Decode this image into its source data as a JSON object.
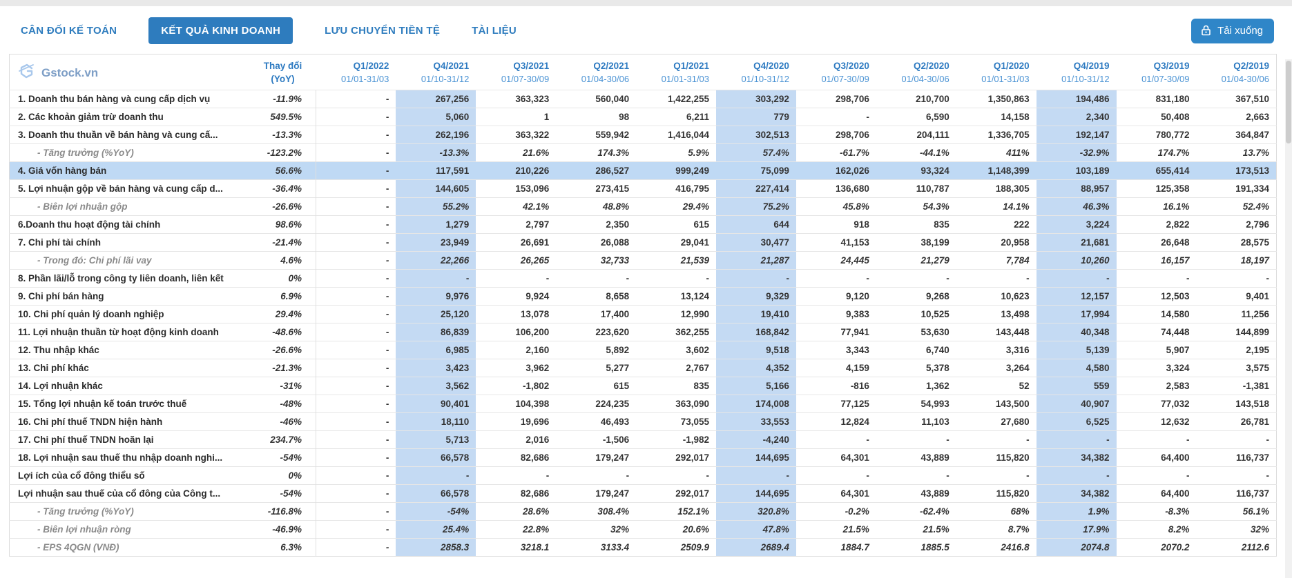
{
  "tabs": [
    {
      "label": "CÂN ĐỐI KẾ TOÁN",
      "active": false
    },
    {
      "label": "KẾT QUẢ KINH DOANH",
      "active": true
    },
    {
      "label": "LƯU CHUYỂN TIỀN TỆ",
      "active": false
    },
    {
      "label": "TÀI LIỆU",
      "active": false
    }
  ],
  "toolbar": {
    "download_label": "Tải xuống"
  },
  "brand": {
    "name": "Gstock.vn"
  },
  "colors": {
    "accent_blue": "#2e7cbe",
    "header_blue": "#2d7ac1",
    "date_blue": "#4b93d4",
    "column_band_blue": "#c4daf3",
    "row_highlight_blue": "#bfd9f4",
    "positive_green": "#318536",
    "negative_red": "#e33b30"
  },
  "table": {
    "change_header_line1": "Thay đổi",
    "change_header_line2": "(YoY)",
    "columns": [
      {
        "quarter": "Q1/2022",
        "range": "01/01-31/03",
        "highlighted": false
      },
      {
        "quarter": "Q4/2021",
        "range": "01/10-31/12",
        "highlighted": true
      },
      {
        "quarter": "Q3/2021",
        "range": "01/07-30/09",
        "highlighted": false
      },
      {
        "quarter": "Q2/2021",
        "range": "01/04-30/06",
        "highlighted": false
      },
      {
        "quarter": "Q1/2021",
        "range": "01/01-31/03",
        "highlighted": false
      },
      {
        "quarter": "Q4/2020",
        "range": "01/10-31/12",
        "highlighted": true
      },
      {
        "quarter": "Q3/2020",
        "range": "01/07-30/09",
        "highlighted": false
      },
      {
        "quarter": "Q2/2020",
        "range": "01/04-30/06",
        "highlighted": false
      },
      {
        "quarter": "Q1/2020",
        "range": "01/01-31/03",
        "highlighted": false
      },
      {
        "quarter": "Q4/2019",
        "range": "01/10-31/12",
        "highlighted": true
      },
      {
        "quarter": "Q3/2019",
        "range": "01/07-30/09",
        "highlighted": false
      },
      {
        "quarter": "Q2/2019",
        "range": "01/04-30/06",
        "highlighted": false
      }
    ],
    "rows": [
      {
        "label": "1. Doanh thu bán hàng và cung cấp dịch vụ",
        "sub": false,
        "italic_values": false,
        "highlighted": false,
        "change": "-11.9%",
        "values": [
          "-",
          "267,256",
          "363,323",
          "560,040",
          "1,422,255",
          "303,292",
          "298,706",
          "210,700",
          "1,350,863",
          "194,486",
          "831,180",
          "367,510"
        ]
      },
      {
        "label": "2. Các khoản giảm trừ doanh thu",
        "sub": false,
        "italic_values": false,
        "highlighted": false,
        "change": "549.5%",
        "values": [
          "-",
          "5,060",
          "1",
          "98",
          "6,211",
          "779",
          "-",
          "6,590",
          "14,158",
          "2,340",
          "50,408",
          "2,663"
        ]
      },
      {
        "label": "3. Doanh thu thuần về bán hàng và cung cấ...",
        "sub": false,
        "italic_values": false,
        "highlighted": false,
        "change": "-13.3%",
        "values": [
          "-",
          "262,196",
          "363,322",
          "559,942",
          "1,416,044",
          "302,513",
          "298,706",
          "204,111",
          "1,336,705",
          "192,147",
          "780,772",
          "364,847"
        ]
      },
      {
        "label": "- Tăng trưởng (%YoY)",
        "sub": true,
        "italic_values": false,
        "highlighted": false,
        "change": "-123.2%",
        "values": [
          "-",
          "-13.3%",
          "21.6%",
          "174.3%",
          "5.9%",
          "57.4%",
          "-61.7%",
          "-44.1%",
          "411%",
          "-32.9%",
          "174.7%",
          "13.7%"
        ]
      },
      {
        "label": "4. Giá vốn hàng bán",
        "sub": false,
        "italic_values": false,
        "highlighted": true,
        "change": "56.6%",
        "values": [
          "-",
          "117,591",
          "210,226",
          "286,527",
          "999,249",
          "75,099",
          "162,026",
          "93,324",
          "1,148,399",
          "103,189",
          "655,414",
          "173,513"
        ]
      },
      {
        "label": "5. Lợi nhuận gộp về bán hàng và cung cấp d...",
        "sub": false,
        "italic_values": false,
        "highlighted": false,
        "change": "-36.4%",
        "values": [
          "-",
          "144,605",
          "153,096",
          "273,415",
          "416,795",
          "227,414",
          "136,680",
          "110,787",
          "188,305",
          "88,957",
          "125,358",
          "191,334"
        ]
      },
      {
        "label": "- Biên lợi nhuận gộp",
        "sub": true,
        "italic_values": false,
        "highlighted": false,
        "change": "-26.6%",
        "values": [
          "-",
          "55.2%",
          "42.1%",
          "48.8%",
          "29.4%",
          "75.2%",
          "45.8%",
          "54.3%",
          "14.1%",
          "46.3%",
          "16.1%",
          "52.4%"
        ]
      },
      {
        "label": "6.Doanh thu hoạt động tài chính",
        "sub": false,
        "italic_values": false,
        "highlighted": false,
        "change": "98.6%",
        "values": [
          "-",
          "1,279",
          "2,797",
          "2,350",
          "615",
          "644",
          "918",
          "835",
          "222",
          "3,224",
          "2,822",
          "2,796"
        ]
      },
      {
        "label": "7. Chi phí tài chính",
        "sub": false,
        "italic_values": false,
        "highlighted": false,
        "change": "-21.4%",
        "values": [
          "-",
          "23,949",
          "26,691",
          "26,088",
          "29,041",
          "30,477",
          "41,153",
          "38,199",
          "20,958",
          "21,681",
          "26,648",
          "28,575"
        ]
      },
      {
        "label": "- Trong đó: Chi phí lãi vay",
        "sub": true,
        "italic_values": true,
        "highlighted": false,
        "change": "4.6%",
        "values": [
          "-",
          "22,266",
          "26,265",
          "32,733",
          "21,539",
          "21,287",
          "24,445",
          "21,279",
          "7,784",
          "10,260",
          "16,157",
          "18,197"
        ]
      },
      {
        "label": "8. Phần lãi/lỗ trong công ty liên doanh, liên kết",
        "sub": false,
        "italic_values": false,
        "highlighted": false,
        "change": "0%",
        "values": [
          "-",
          "-",
          "-",
          "-",
          "-",
          "-",
          "-",
          "-",
          "-",
          "-",
          "-",
          "-"
        ]
      },
      {
        "label": "9. Chi phí bán hàng",
        "sub": false,
        "italic_values": false,
        "highlighted": false,
        "change": "6.9%",
        "values": [
          "-",
          "9,976",
          "9,924",
          "8,658",
          "13,124",
          "9,329",
          "9,120",
          "9,268",
          "10,623",
          "12,157",
          "12,503",
          "9,401"
        ]
      },
      {
        "label": "10. Chi phí quản lý doanh nghiệp",
        "sub": false,
        "italic_values": false,
        "highlighted": false,
        "change": "29.4%",
        "values": [
          "-",
          "25,120",
          "13,078",
          "17,400",
          "12,990",
          "19,410",
          "9,383",
          "10,525",
          "13,498",
          "17,994",
          "14,580",
          "11,256"
        ]
      },
      {
        "label": "11. Lợi nhuận thuần từ hoạt động kinh doanh",
        "sub": false,
        "italic_values": false,
        "highlighted": false,
        "change": "-48.6%",
        "values": [
          "-",
          "86,839",
          "106,200",
          "223,620",
          "362,255",
          "168,842",
          "77,941",
          "53,630",
          "143,448",
          "40,348",
          "74,448",
          "144,899"
        ]
      },
      {
        "label": "12. Thu nhập khác",
        "sub": false,
        "italic_values": false,
        "highlighted": false,
        "change": "-26.6%",
        "values": [
          "-",
          "6,985",
          "2,160",
          "5,892",
          "3,602",
          "9,518",
          "3,343",
          "6,740",
          "3,316",
          "5,139",
          "5,907",
          "2,195"
        ]
      },
      {
        "label": "13. Chi phí khác",
        "sub": false,
        "italic_values": false,
        "highlighted": false,
        "change": "-21.3%",
        "values": [
          "-",
          "3,423",
          "3,962",
          "5,277",
          "2,767",
          "4,352",
          "4,159",
          "5,378",
          "3,264",
          "4,580",
          "3,324",
          "3,575"
        ]
      },
      {
        "label": "14. Lợi nhuận khác",
        "sub": false,
        "italic_values": false,
        "highlighted": false,
        "change": "-31%",
        "values": [
          "-",
          "3,562",
          "-1,802",
          "615",
          "835",
          "5,166",
          "-816",
          "1,362",
          "52",
          "559",
          "2,583",
          "-1,381"
        ]
      },
      {
        "label": "15. Tổng lợi nhuận kế toán trước thuế",
        "sub": false,
        "italic_values": false,
        "highlighted": false,
        "change": "-48%",
        "values": [
          "-",
          "90,401",
          "104,398",
          "224,235",
          "363,090",
          "174,008",
          "77,125",
          "54,993",
          "143,500",
          "40,907",
          "77,032",
          "143,518"
        ]
      },
      {
        "label": "16. Chi phí thuế TNDN hiện hành",
        "sub": false,
        "italic_values": false,
        "highlighted": false,
        "change": "-46%",
        "values": [
          "-",
          "18,110",
          "19,696",
          "46,493",
          "73,055",
          "33,553",
          "12,824",
          "11,103",
          "27,680",
          "6,525",
          "12,632",
          "26,781"
        ]
      },
      {
        "label": "17. Chi phí thuế TNDN hoãn lại",
        "sub": false,
        "italic_values": false,
        "highlighted": false,
        "change": "234.7%",
        "values": [
          "-",
          "5,713",
          "2,016",
          "-1,506",
          "-1,982",
          "-4,240",
          "-",
          "-",
          "-",
          "-",
          "-",
          "-"
        ]
      },
      {
        "label": "18. Lợi nhuận sau thuế thu nhập doanh nghi...",
        "sub": false,
        "italic_values": false,
        "highlighted": false,
        "change": "-54%",
        "values": [
          "-",
          "66,578",
          "82,686",
          "179,247",
          "292,017",
          "144,695",
          "64,301",
          "43,889",
          "115,820",
          "34,382",
          "64,400",
          "116,737"
        ]
      },
      {
        "label": "Lợi ích của cổ đông thiểu số",
        "sub": false,
        "italic_values": false,
        "highlighted": false,
        "change": "0%",
        "values": [
          "-",
          "-",
          "-",
          "-",
          "-",
          "-",
          "-",
          "-",
          "-",
          "-",
          "-",
          "-"
        ]
      },
      {
        "label": "Lợi nhuận sau thuế của cổ đông của Công t...",
        "sub": false,
        "italic_values": false,
        "highlighted": false,
        "change": "-54%",
        "values": [
          "-",
          "66,578",
          "82,686",
          "179,247",
          "292,017",
          "144,695",
          "64,301",
          "43,889",
          "115,820",
          "34,382",
          "64,400",
          "116,737"
        ]
      },
      {
        "label": "- Tăng trưởng (%YoY)",
        "sub": true,
        "italic_values": false,
        "highlighted": false,
        "change": "-116.8%",
        "values": [
          "-",
          "-54%",
          "28.6%",
          "308.4%",
          "152.1%",
          "320.8%",
          "-0.2%",
          "-62.4%",
          "68%",
          "1.9%",
          "-8.3%",
          "56.1%"
        ]
      },
      {
        "label": "- Biên lợi nhuận ròng",
        "sub": true,
        "italic_values": false,
        "highlighted": false,
        "change": "-46.9%",
        "values": [
          "-",
          "25.4%",
          "22.8%",
          "32%",
          "20.6%",
          "47.8%",
          "21.5%",
          "21.5%",
          "8.7%",
          "17.9%",
          "8.2%",
          "32%"
        ]
      },
      {
        "label": "- EPS 4QGN (VNĐ)",
        "sub": true,
        "italic_values": true,
        "highlighted": false,
        "change": "6.3%",
        "values": [
          "-",
          "2858.3",
          "3218.1",
          "3133.4",
          "2509.9",
          "2689.4",
          "1884.7",
          "1885.5",
          "2416.8",
          "2074.8",
          "2070.2",
          "2112.6"
        ]
      }
    ]
  }
}
